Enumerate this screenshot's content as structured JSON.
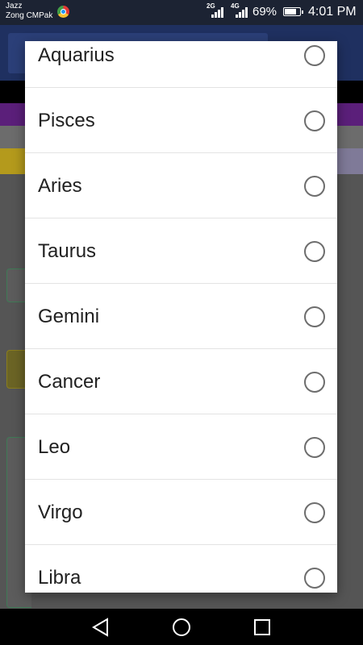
{
  "status_bar": {
    "carrier_1": "Jazz",
    "carrier_2": "Zong CMPak",
    "network_1": "2G",
    "network_2": "4G",
    "battery": "69%",
    "time": "4:01 PM"
  },
  "dialog": {
    "options": [
      {
        "label": "Aquarius",
        "selected": false
      },
      {
        "label": "Pisces",
        "selected": false
      },
      {
        "label": "Aries",
        "selected": false
      },
      {
        "label": "Taurus",
        "selected": false
      },
      {
        "label": "Gemini",
        "selected": false
      },
      {
        "label": "Cancer",
        "selected": false
      },
      {
        "label": "Leo",
        "selected": false
      },
      {
        "label": "Virgo",
        "selected": false
      },
      {
        "label": "Libra",
        "selected": false
      }
    ]
  },
  "navbar": {
    "back_icon": "triangle-back-icon",
    "home_icon": "circle-home-icon",
    "recents_icon": "square-recents-icon"
  }
}
